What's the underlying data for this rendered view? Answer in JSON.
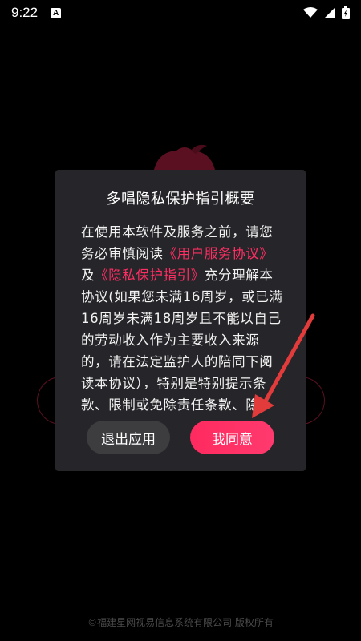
{
  "status_bar": {
    "time": "9:22",
    "notification_badge": "A",
    "icons": [
      "wifi-icon",
      "signal-icon",
      "battery-icon"
    ]
  },
  "dialog": {
    "title": "多唱隐私保护指引概要",
    "body": {
      "seg1": "在使用本软件及服务之前，请您务必审慎阅读",
      "link1": "《用户服务协议》",
      "seg2": "及",
      "link2": "《隐私保护指引》",
      "seg3": "充分理解本协议(如果您未满16周岁，或已满16周岁未满18周岁且不能以自己的劳动收入作为主要收入来源的，请在法定监护人的陪同下阅读本协议），特别是特别提示条款、限制或免除责任条款、隐"
    },
    "exit_button": "退出应用",
    "agree_button": "我同意"
  },
  "footer": {
    "copyright": "©福建星网视易信息系统有限公司 版权所有"
  },
  "colors": {
    "accent": "#ff2e63",
    "dialog_bg": "#26262a",
    "annotation_arrow": "#e23b3b"
  }
}
